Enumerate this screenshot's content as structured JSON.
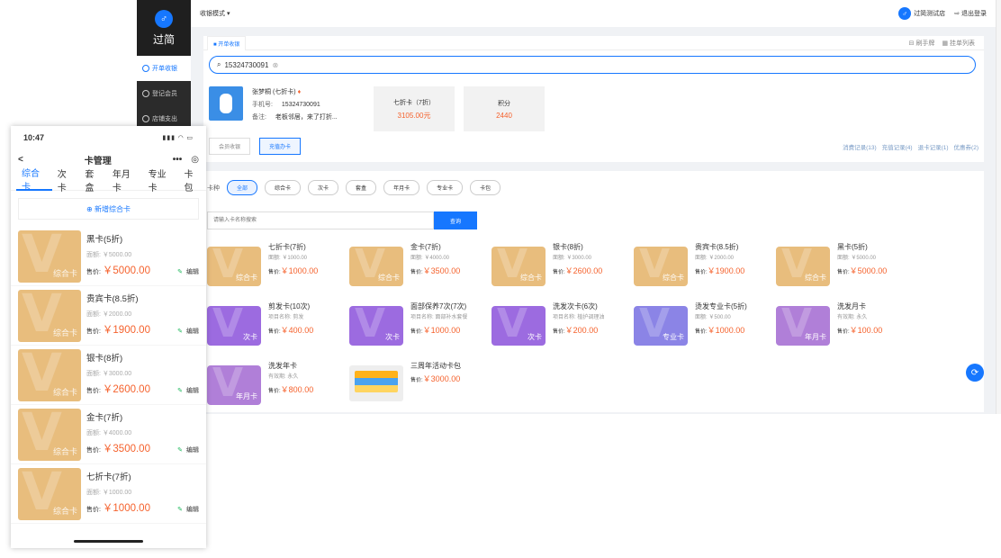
{
  "app": {
    "logo_mark": "♂",
    "name": "过简"
  },
  "sidebar": {
    "items": [
      {
        "icon": "cashier-icon",
        "label": "开单收银",
        "active": true
      },
      {
        "icon": "member-icon",
        "label": "登记会员",
        "active": false
      },
      {
        "icon": "expense-icon",
        "label": "店铺支出",
        "active": false
      }
    ]
  },
  "topbar": {
    "mode": "收银模式 ▾",
    "store_name": "过简测试店",
    "logout": "退出登录"
  },
  "tab": {
    "label": "开单收银",
    "tools": [
      "刷手牌",
      "挂单列表"
    ]
  },
  "search": {
    "value": "15324730091",
    "clear": "⊗"
  },
  "member": {
    "name": "张梦桐 (七折卡)",
    "phone_label": "手机号:",
    "phone": "15324730091",
    "note_label": "备注:",
    "note": "老板邻居，来了打折..."
  },
  "stats": [
    {
      "label": "七折卡（7折）",
      "value": "3105.00元"
    },
    {
      "label": "积分",
      "value": "2440"
    }
  ],
  "actions": {
    "buttons": [
      "会员收银",
      "充值办卡"
    ],
    "active_index": 1
  },
  "records": [
    "消费记录(13)",
    "充值记录(4)",
    "退卡记录(1)",
    "优惠券(2)"
  ],
  "filter": {
    "label": "卡种",
    "chips": [
      "全部",
      "综合卡",
      "次卡",
      "套盒",
      "年月卡",
      "专业卡",
      "卡包"
    ],
    "active_index": 0
  },
  "card_search": {
    "placeholder": "请输入卡名称搜索",
    "button": "查询"
  },
  "cards": [
    {
      "name": "七折卡(7折)",
      "sub": "面额: ￥1000.00",
      "price_label": "售价:",
      "price": "￥1000.00",
      "tag": "综合卡",
      "color": "#e8bd7d"
    },
    {
      "name": "金卡(7折)",
      "sub": "面额: ￥4000.00",
      "price_label": "售价:",
      "price": "￥3500.00",
      "tag": "综合卡",
      "color": "#e8bd7d"
    },
    {
      "name": "银卡(8折)",
      "sub": "面额: ￥3000.00",
      "price_label": "售价:",
      "price": "￥2600.00",
      "tag": "综合卡",
      "color": "#e8bd7d"
    },
    {
      "name": "贵宾卡(8.5折)",
      "sub": "面额: ￥2000.00",
      "price_label": "售价:",
      "price": "￥1900.00",
      "tag": "综合卡",
      "color": "#e8bd7d"
    },
    {
      "name": "黑卡(5折)",
      "sub": "面额: ￥5000.00",
      "price_label": "售价:",
      "price": "￥5000.00",
      "tag": "综合卡",
      "color": "#e8bd7d"
    },
    {
      "name": "剪发卡(10次)",
      "sub": "项目名称: 剪发",
      "price_label": "售价:",
      "price": "￥400.00",
      "tag": "次卡",
      "color": "#9c6be0"
    },
    {
      "name": "面部保养7次(7次)",
      "sub": "项目名称: 面部补水套餐",
      "price_label": "售价:",
      "price": "￥1000.00",
      "tag": "次卡",
      "color": "#9c6be0"
    },
    {
      "name": "洗发次卡(6次)",
      "sub": "项目名称: 植护调理油",
      "price_label": "售价:",
      "price": "￥200.00",
      "tag": "次卡",
      "color": "#9c6be0"
    },
    {
      "name": "烫发专业卡(5折)",
      "sub": "面额: ￥500.00",
      "price_label": "售价:",
      "price": "￥1000.00",
      "tag": "专业卡",
      "color": "#8b84e6"
    },
    {
      "name": "洗发月卡",
      "sub": "有效期: 永久",
      "price_label": "售价:",
      "price": "￥100.00",
      "tag": "年月卡",
      "color": "#b07fd8"
    },
    {
      "name": "洗发年卡",
      "sub": "有效期: 永久",
      "price_label": "售价:",
      "price": "￥800.00",
      "tag": "年月卡",
      "color": "#b07fd8"
    },
    {
      "name": "三周年活动卡包",
      "sub": "",
      "price_label": "售价:",
      "price": "￥3000.00",
      "tag": "",
      "color": "wallet"
    }
  ],
  "phone": {
    "time": "10:47",
    "status_icons": "▮▮▮ ◠ ▭",
    "title": "卡管理",
    "back": "<",
    "more": "•••",
    "target": "◎",
    "tabs": [
      "综合卡",
      "次卡",
      "套盒",
      "年月卡",
      "专业卡",
      "卡包"
    ],
    "active_tab": 0,
    "add_label": "⊕ 新增综合卡",
    "thumb_label": "综合卡",
    "edit_label": "编辑",
    "cards": [
      {
        "name": "黑卡(5折)",
        "face": "面额: ￥5000.00",
        "price_label": "售价:",
        "price": "￥5000.00"
      },
      {
        "name": "贵宾卡(8.5折)",
        "face": "面额: ￥2000.00",
        "price_label": "售价:",
        "price": "￥1900.00"
      },
      {
        "name": "银卡(8折)",
        "face": "面额: ￥3000.00",
        "price_label": "售价:",
        "price": "￥2600.00"
      },
      {
        "name": "金卡(7折)",
        "face": "面额: ￥4000.00",
        "price_label": "售价:",
        "price": "￥3500.00"
      },
      {
        "name": "七折卡(7折)",
        "face": "面额: ￥1000.00",
        "price_label": "售价:",
        "price": "￥1000.00"
      }
    ]
  },
  "float_button": "⟳"
}
